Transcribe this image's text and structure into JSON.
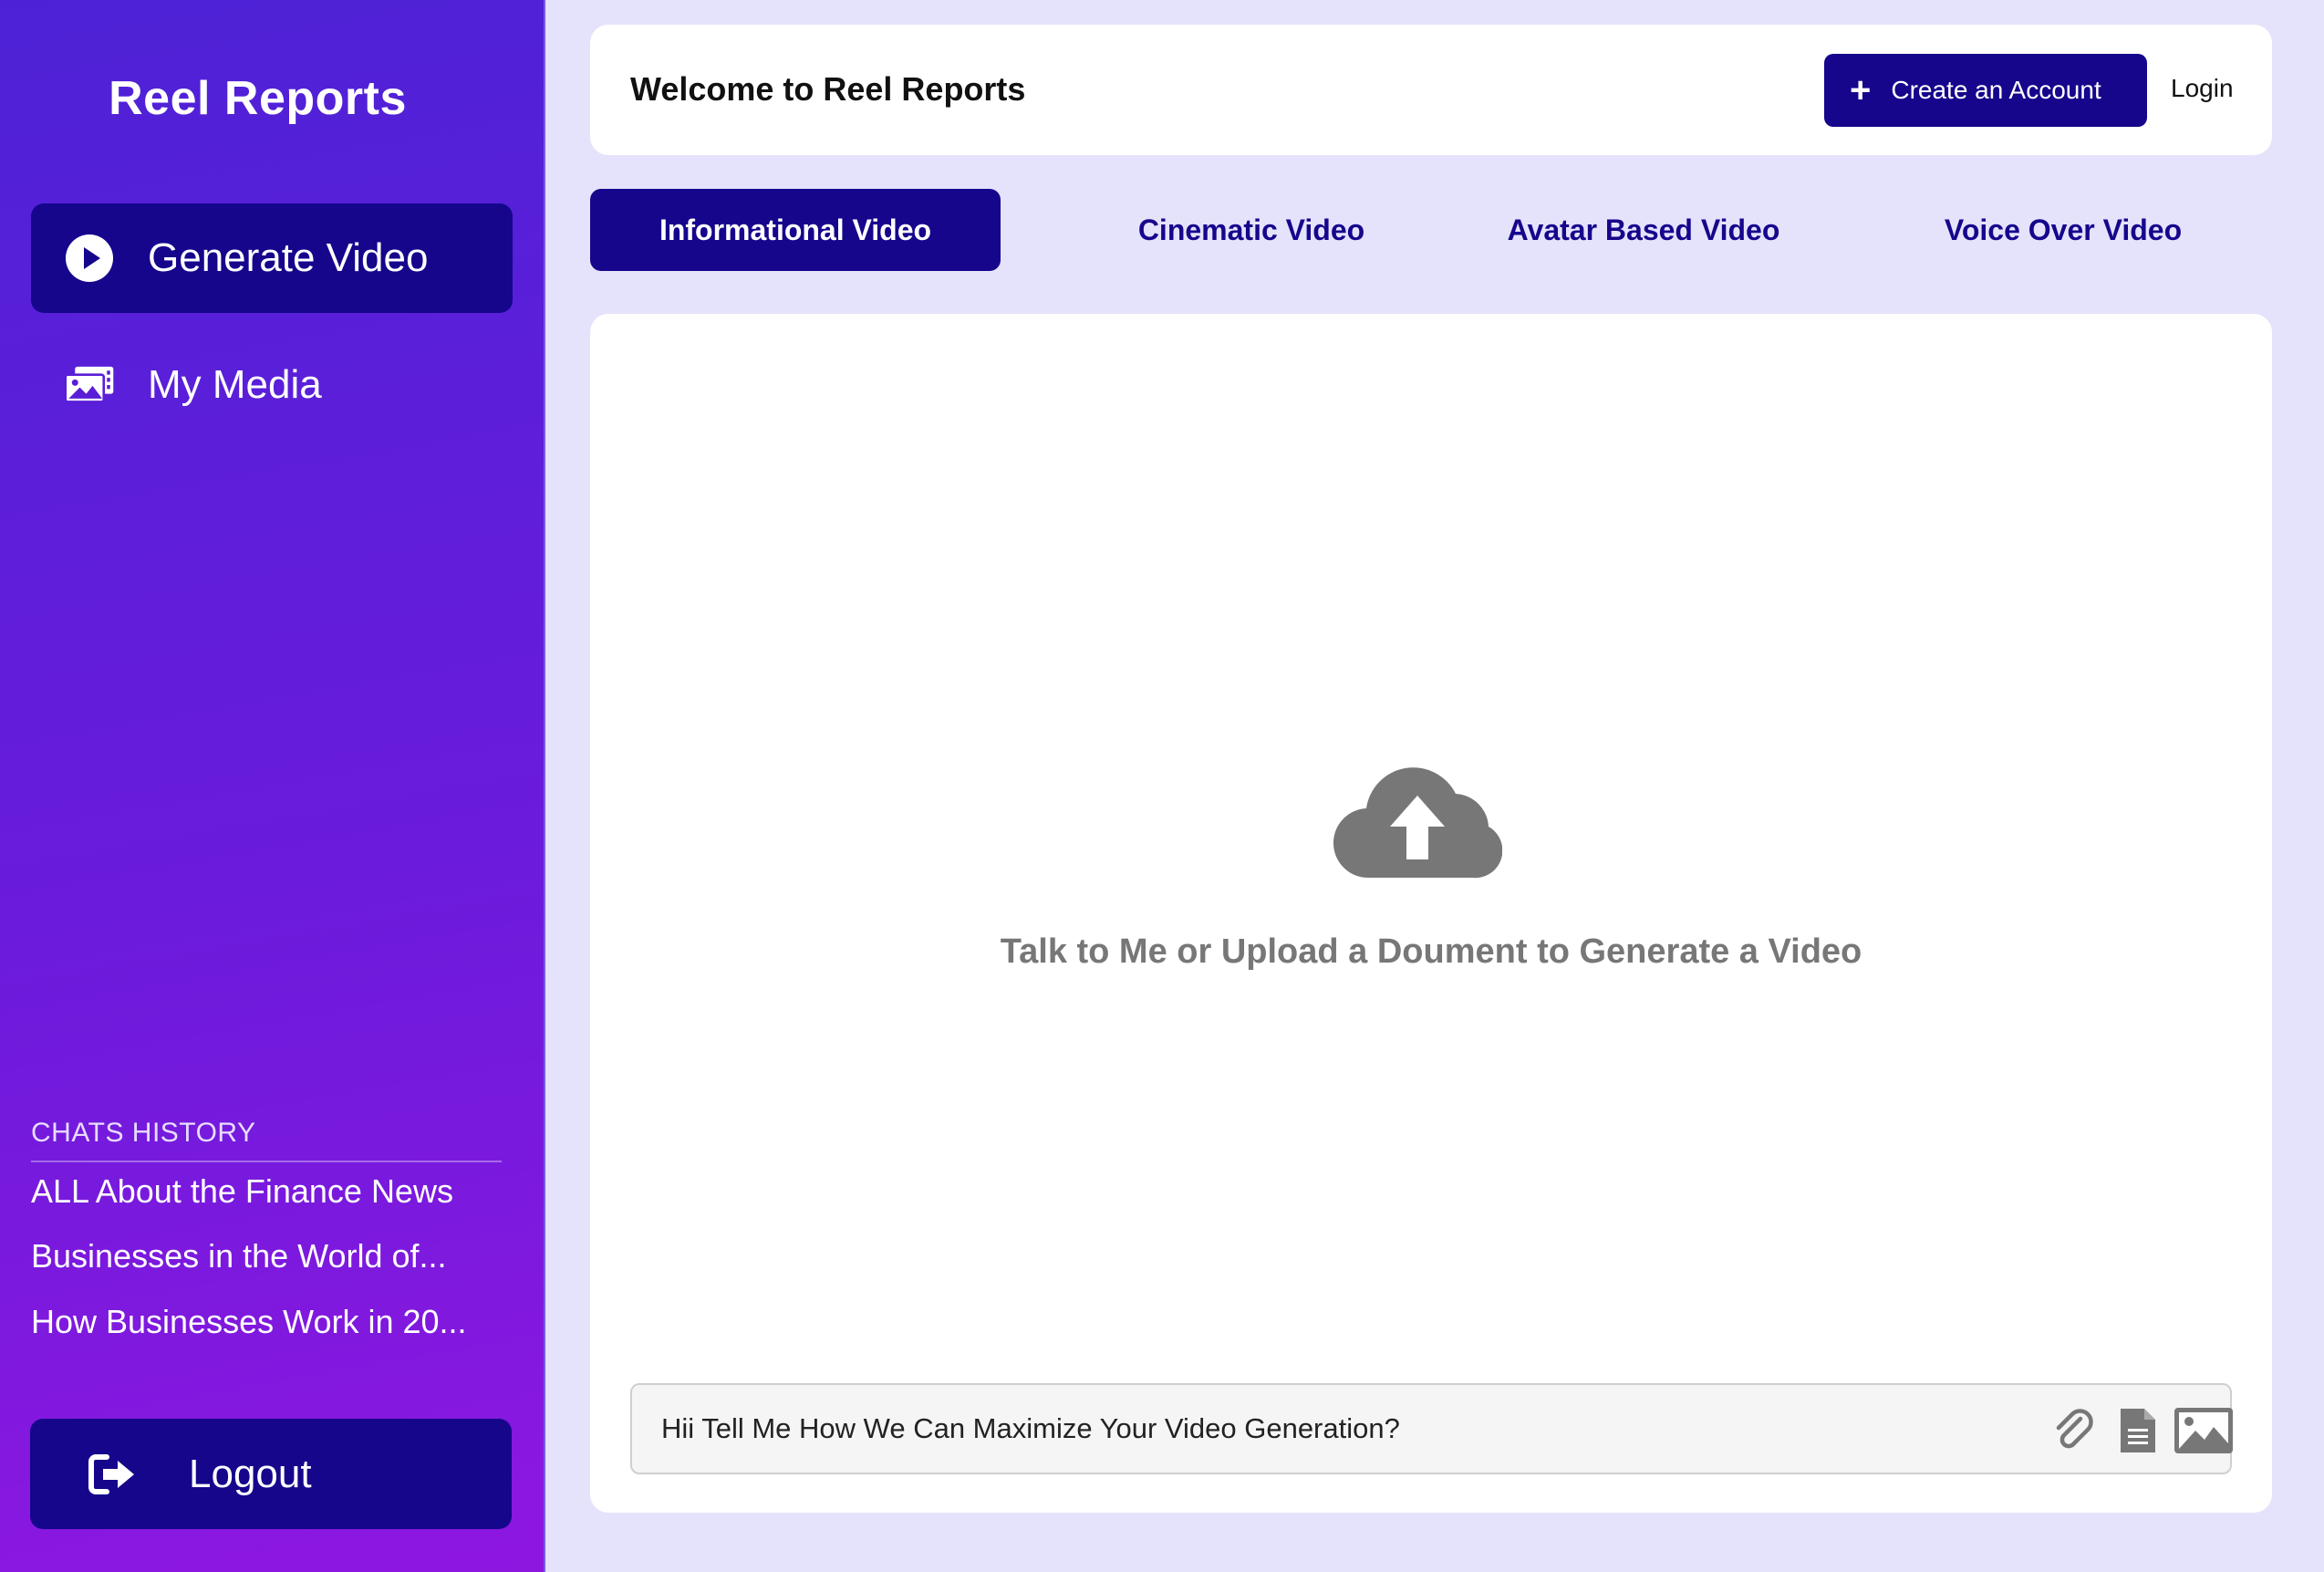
{
  "app": {
    "title": "Reel Reports"
  },
  "sidebar": {
    "nav": [
      {
        "label": "Generate Video",
        "icon": "play-circle-icon",
        "active": true
      },
      {
        "label": "My Media",
        "icon": "media-gallery-icon",
        "active": false
      }
    ],
    "history_title": "CHATS HISTORY",
    "history": [
      "ALL About the Finance News",
      "Businesses in the World of...",
      "How Businesses Work in 20..."
    ],
    "logout_label": "Logout"
  },
  "header": {
    "welcome": "Welcome to Reel Reports",
    "create_account_label": "Create an Account",
    "login_label": "Login"
  },
  "tabs": [
    {
      "label": "Informational Video",
      "active": true
    },
    {
      "label": "Cinematic Video",
      "active": false
    },
    {
      "label": "Avatar Based Video",
      "active": false
    },
    {
      "label": "Voice Over Video",
      "active": false
    }
  ],
  "main": {
    "upload_icon": "cloud-upload-icon",
    "prompt": "Talk to Me or Upload a Doument to Generate a Video",
    "input_value": "Hii Tell Me How We Can Maximize Your Video Generation?",
    "input_icons": [
      "paperclip-icon",
      "document-icon",
      "image-icon"
    ]
  },
  "colors": {
    "primary": "#15068c",
    "sidebar_gradient_start": "#4d22d6",
    "sidebar_gradient_end": "#8e17e0",
    "page_bg": "#e5e2fb",
    "muted_icon": "#777777"
  }
}
